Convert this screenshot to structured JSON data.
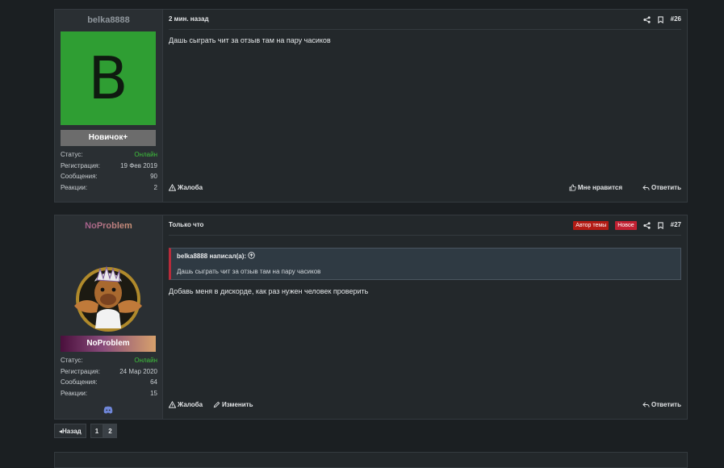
{
  "posts": [
    {
      "username": "belka8888",
      "avatar_letter": "B",
      "avatar_color": "#2f9e33",
      "rank": "Новичок+",
      "stats": [
        {
          "label": "Статус:",
          "value": "Онлайн"
        },
        {
          "label": "Регистрация:",
          "value": "19 Фев 2019"
        },
        {
          "label": "Сообщения:",
          "value": "90"
        },
        {
          "label": "Реакции:",
          "value": "2"
        }
      ],
      "time": "2 мин. назад",
      "number": "#26",
      "message": "Дашь сыграть чит за отзыв там на пару часиков",
      "actions": {
        "report": "Жалоба",
        "like": "Мне нравится",
        "reply": "Ответить"
      }
    },
    {
      "username": "NoProblem",
      "avatar_icon": "alf-character-avatar",
      "rank": "NoProblem",
      "stats": [
        {
          "label": "Статус:",
          "value": "Онлайн"
        },
        {
          "label": "Регистрация:",
          "value": "24 Мар 2020"
        },
        {
          "label": "Сообщения:",
          "value": "64"
        },
        {
          "label": "Реакции:",
          "value": "15"
        }
      ],
      "time": "Только что",
      "badges": {
        "author": "Автор темы",
        "new": "Новое"
      },
      "number": "#27",
      "quote": {
        "author": "belka8888 написал(а):",
        "text": "Дашь сыграть чит за отзыв там на пару часиков"
      },
      "message": "Добавь меня в дискорде, как раз нужен человек проверить",
      "actions": {
        "report": "Жалоба",
        "edit": "Изменить",
        "reply": "Ответить"
      }
    }
  ],
  "pagination": {
    "prev": "Назад",
    "pages": [
      "1",
      "2"
    ]
  },
  "colors": {
    "online": "#3fc13c",
    "accent_quote": "#b72b3a",
    "badge_author": "#b21b14",
    "badge_new": "#c12032"
  }
}
